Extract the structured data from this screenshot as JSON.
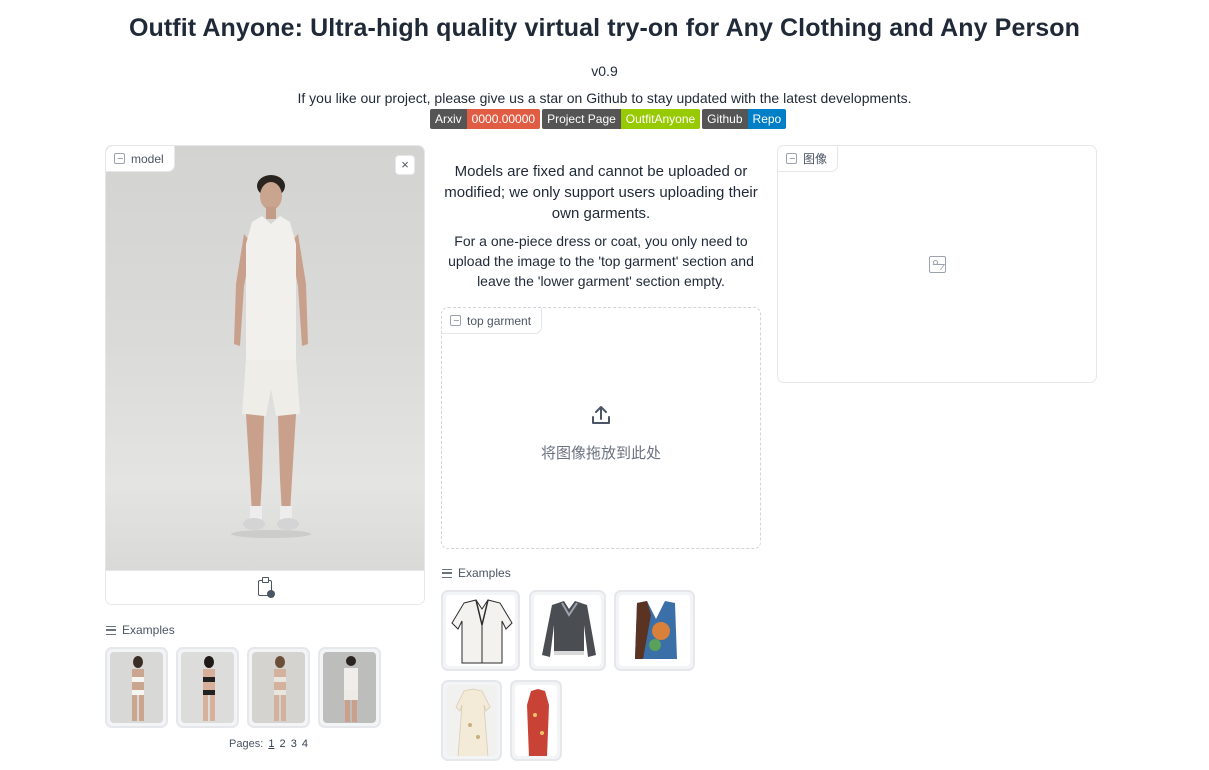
{
  "header": {
    "title": "Outfit Anyone: Ultra-high quality virtual try-on for Any Clothing and Any Person",
    "version": "v0.9",
    "subtitle": "If you like our project, please give us a star on Github to stay updated with the latest developments."
  },
  "badges": [
    {
      "left": "Arxiv",
      "right": "0000.00000",
      "right_color": "#e05d44"
    },
    {
      "left": "Project Page",
      "right": "OutfitAnyone",
      "right_color": "#97ca00"
    },
    {
      "left": "Github",
      "right": "Repo",
      "right_color": "#007ec6"
    }
  ],
  "model_panel": {
    "label": "model",
    "close_label": "×",
    "examples_label": "Examples",
    "pages_label": "Pages:",
    "pages": [
      "1",
      "2",
      "3",
      "4"
    ],
    "example_count": 4
  },
  "info": {
    "line1": "Models are fixed and cannot be uploaded or modified; we only support users uploading their own garments.",
    "line2": "For a one-piece dress or coat, you only need to upload the image to the 'top garment' section and leave the 'lower garment' section empty."
  },
  "garment_panel": {
    "label": "top garment",
    "drop_text": "将图像拖放到此处",
    "examples_label": "Examples",
    "example_items": [
      "white-cardigan",
      "grey-polo-sweater",
      "floral-vest",
      "cream-dress",
      "red-floral-dress"
    ]
  },
  "result_panel": {
    "label": "图像"
  },
  "icons": [
    "image-icon",
    "close-icon",
    "clipboard-icon",
    "list-icon",
    "upload-icon"
  ]
}
